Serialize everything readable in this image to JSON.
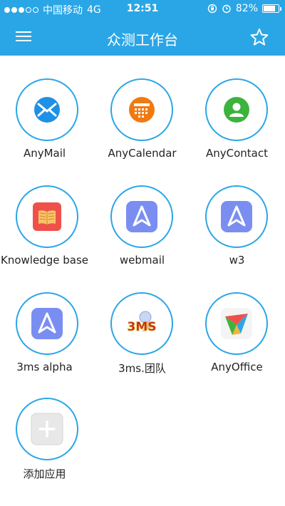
{
  "status": {
    "carrier": "中国移动",
    "network": "4G",
    "time": "12:51",
    "battery": "82%",
    "battery_level": 0.82
  },
  "header": {
    "title": "众测工作台",
    "menu_icon": "hamburger-menu-icon",
    "star_icon": "star-outline-icon"
  },
  "colors": {
    "header": "#2aa6e6",
    "circle_border": "#2aa6e6",
    "mail_blue": "#1e90e6",
    "calendar_orange": "#f07a12",
    "contact_green": "#3cb33c",
    "knowledge_red": "#f0504a",
    "webmail_purple": "#7a8ef2"
  },
  "apps": [
    {
      "label": "AnyMail",
      "icon": "anymail-icon"
    },
    {
      "label": "AnyCalendar",
      "icon": "anycalendar-icon"
    },
    {
      "label": "AnyContact",
      "icon": "anycontact-icon"
    },
    {
      "label": "Knowledge base",
      "icon": "knowledge-base-book-icon"
    },
    {
      "label": "webmail",
      "icon": "webmail-arrow-icon"
    },
    {
      "label": "w3",
      "icon": "w3-arrow-icon"
    },
    {
      "label": "3ms alpha",
      "icon": "3ms-alpha-arrow-icon"
    },
    {
      "label": "3ms.团队",
      "icon": "3ms-team-logo-icon",
      "logo_text": "3MS"
    },
    {
      "label": "AnyOffice",
      "icon": "anyoffice-logo-icon"
    },
    {
      "label": "添加应用",
      "icon": "add-app-plus-icon"
    }
  ]
}
